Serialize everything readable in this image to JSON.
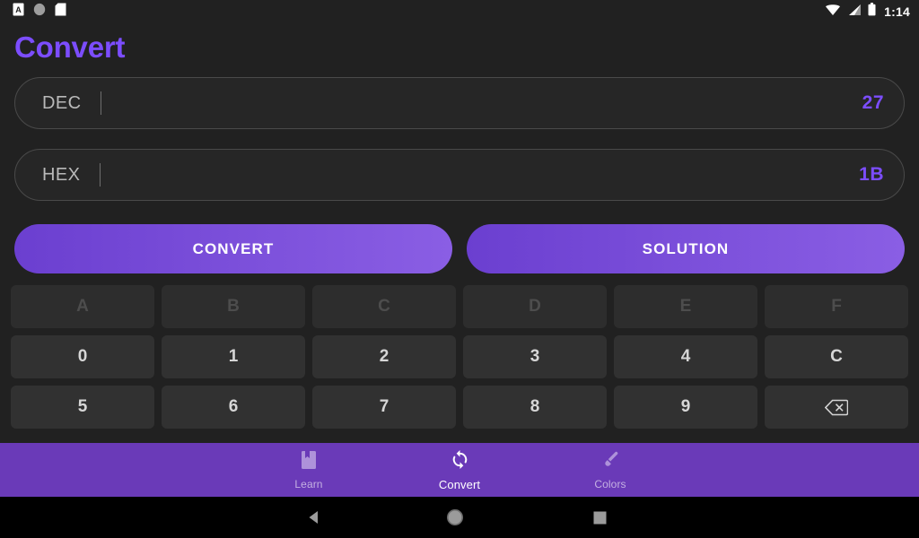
{
  "status_bar": {
    "left_icons": [
      "letter-a-notification-icon",
      "circle-notification-icon",
      "sdcard-notification-icon"
    ],
    "right_icons": [
      "wifi-icon",
      "cellular-signal-icon",
      "battery-icon"
    ],
    "time": "1:14"
  },
  "header": {
    "title": "Convert",
    "title_color": "#7C4DFF"
  },
  "fields": [
    {
      "label": "DEC",
      "value": "27",
      "placeholder": ""
    },
    {
      "label": "HEX",
      "value": "1B",
      "placeholder": ""
    }
  ],
  "actions": [
    {
      "label": "CONVERT"
    },
    {
      "label": "SOLUTION"
    }
  ],
  "keypad": {
    "rows": [
      [
        {
          "label": "A",
          "disabled": true
        },
        {
          "label": "B",
          "disabled": true
        },
        {
          "label": "C",
          "disabled": true
        },
        {
          "label": "D",
          "disabled": true
        },
        {
          "label": "E",
          "disabled": true
        },
        {
          "label": "F",
          "disabled": true
        }
      ],
      [
        {
          "label": "0",
          "disabled": false
        },
        {
          "label": "1",
          "disabled": false
        },
        {
          "label": "2",
          "disabled": false
        },
        {
          "label": "3",
          "disabled": false
        },
        {
          "label": "4",
          "disabled": false
        },
        {
          "label": "C",
          "disabled": false
        }
      ],
      [
        {
          "label": "5",
          "disabled": false
        },
        {
          "label": "6",
          "disabled": false
        },
        {
          "label": "7",
          "disabled": false
        },
        {
          "label": "8",
          "disabled": false
        },
        {
          "label": "9",
          "disabled": false
        },
        {
          "label": "",
          "icon": "backspace-icon",
          "disabled": false
        }
      ]
    ]
  },
  "bottom_nav": {
    "background": "#6A3AB8",
    "items": [
      {
        "label": "Learn",
        "icon": "book-icon",
        "active": false
      },
      {
        "label": "Convert",
        "icon": "sync-icon",
        "active": true
      },
      {
        "label": "Colors",
        "icon": "paintbrush-icon",
        "active": false
      }
    ]
  },
  "system_nav": {
    "back": "back-icon",
    "home": "home-icon",
    "recents": "recents-icon"
  }
}
